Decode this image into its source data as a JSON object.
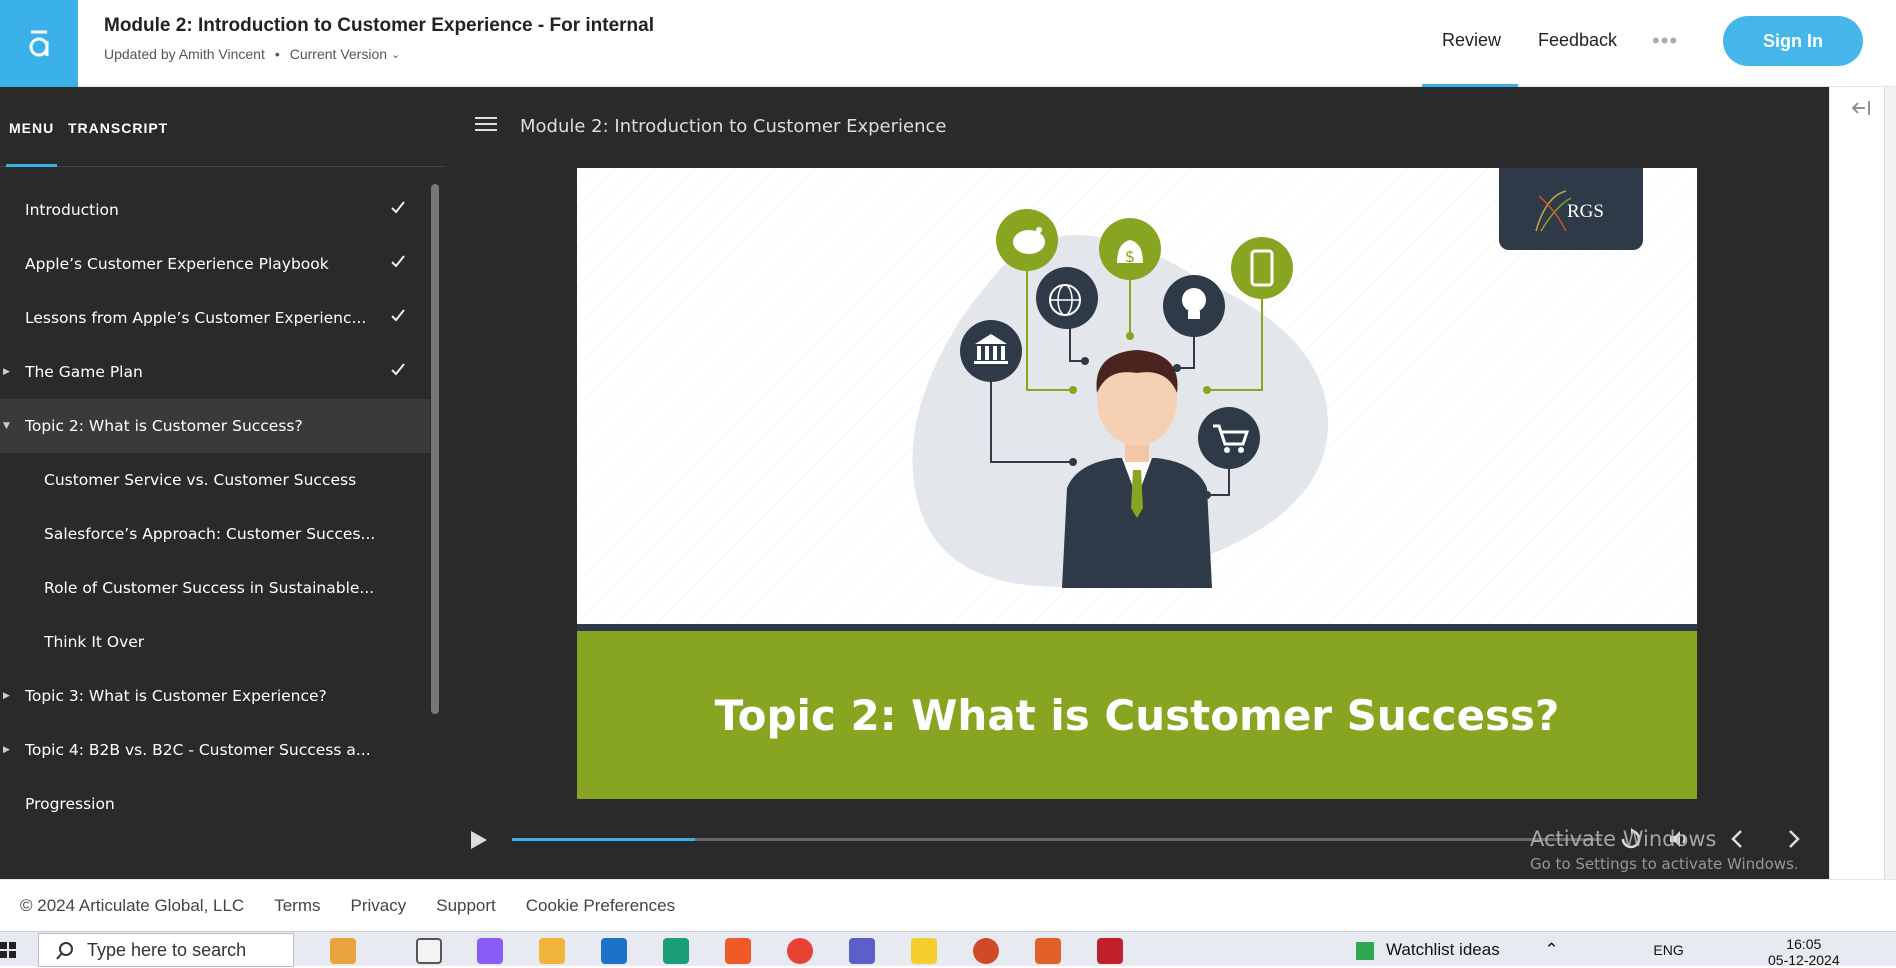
{
  "header": {
    "title": "Module 2: Introduction to Customer Experience - For internal",
    "updated_by": "Updated by Amith Vincent",
    "version": "Current Version",
    "nav_review": "Review",
    "nav_feedback": "Feedback",
    "more": "•••",
    "signin": "Sign In"
  },
  "sidebar": {
    "tab_menu": "MENU",
    "tab_transcript": "TRANSCRIPT",
    "items": [
      {
        "label": "Introduction",
        "completed": true
      },
      {
        "label": "Apple’s Customer Experience Playbook",
        "completed": true
      },
      {
        "label": "Lessons from Apple’s Customer Experienc...",
        "completed": true
      },
      {
        "label": "The Game Plan",
        "completed": true
      },
      {
        "label": "Topic 2: What is Customer Success?",
        "active": true
      },
      {
        "label": "Customer Service vs. Customer Success"
      },
      {
        "label": "Salesforce’s Approach: Customer Succes..."
      },
      {
        "label": "Role of Customer Success in Sustainable..."
      },
      {
        "label": "Think It Over"
      },
      {
        "label": "Topic 3: What is Customer Experience?"
      },
      {
        "label": "Topic 4: B2B vs. B2C - Customer Success a..."
      },
      {
        "label": "Progression"
      }
    ]
  },
  "main": {
    "module_title": "Module 2: Introduction to Customer Experience",
    "slide_logo": "RGS",
    "slide_heading": "Topic 2: What is Customer Success?",
    "progress": 0.168
  },
  "watermark": {
    "line1": "Activate Windows",
    "line2": "Go to Settings to activate Windows."
  },
  "footer": {
    "copyright": "© 2024 Articulate Global, LLC",
    "terms": "Terms",
    "privacy": "Privacy",
    "support": "Support",
    "cookies": "Cookie Preferences"
  },
  "taskbar": {
    "search_placeholder": "Type here to search",
    "widget": "Watchlist ideas",
    "lang": "ENG",
    "time": "16:05",
    "date": "05-12-2024"
  },
  "colors": {
    "accent": "#3ab1e8",
    "panel": "#2a2a2a",
    "banner": "#88a522",
    "navy": "#2f3a48"
  }
}
